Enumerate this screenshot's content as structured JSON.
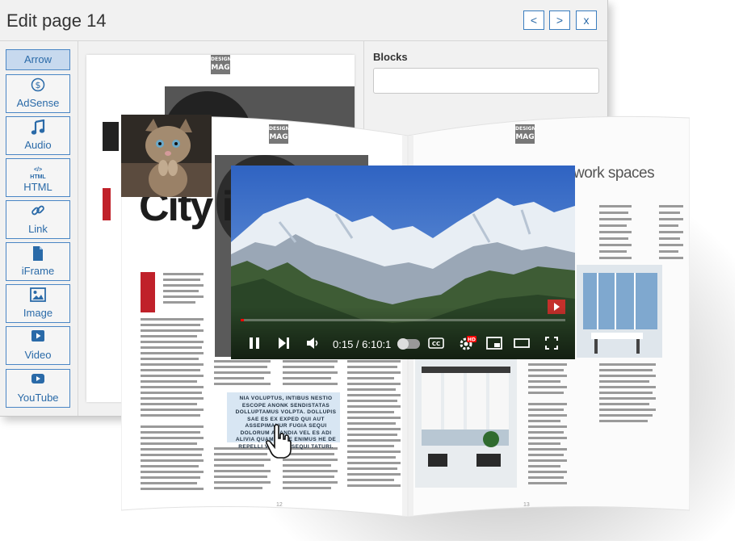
{
  "window": {
    "title": "Edit page 14",
    "nav": {
      "prev": "<",
      "next": ">",
      "close": "x"
    }
  },
  "toolbox": [
    {
      "label": "Arrow",
      "icon": "arrow-icon",
      "selected": true
    },
    {
      "label": "AdSense",
      "icon": "dollar-icon"
    },
    {
      "label": "Audio",
      "icon": "music-note-icon"
    },
    {
      "label": "HTML",
      "icon": "html-icon",
      "icon_text": "HTML"
    },
    {
      "label": "Link",
      "icon": "link-icon"
    },
    {
      "label": "iFrame",
      "icon": "file-icon"
    },
    {
      "label": "Image",
      "icon": "image-icon"
    },
    {
      "label": "Video",
      "icon": "video-icon"
    },
    {
      "label": "YouTube",
      "icon": "youtube-icon"
    }
  ],
  "properties": {
    "blocks_label": "Blocks",
    "blocks_value": ""
  },
  "magazine": {
    "logo_top": "DESIGN",
    "logo_bottom": "MAG",
    "headline": "City in",
    "quote": "NIA VOLUPTUS, INTIBUS NESTIO ESCOPE ANONK SENDISTATAS DOLLUPTAMUS VOLPTA. DOLLUPIS SAE ES EX EXPED QUI AUT ASSEPIMANUR FUGIA SEQUI DOLORUM ANANDIA VEL ES ADI ALIVIA QUAM, SAVE ENIMUS HE DE REPELLI VOLUPTI SEQUI TATURI.",
    "section_title": "work spaces",
    "left_page_number": "12",
    "right_page_number": "13"
  },
  "video": {
    "time": "0:15 / 6:10:1",
    "progress": 0.004,
    "quality_badge": "HD",
    "cc_label": "CC",
    "colors": {
      "sky": "#3a6fc0",
      "progress": "#ff0000",
      "youtube_red": "#c4302b"
    }
  }
}
